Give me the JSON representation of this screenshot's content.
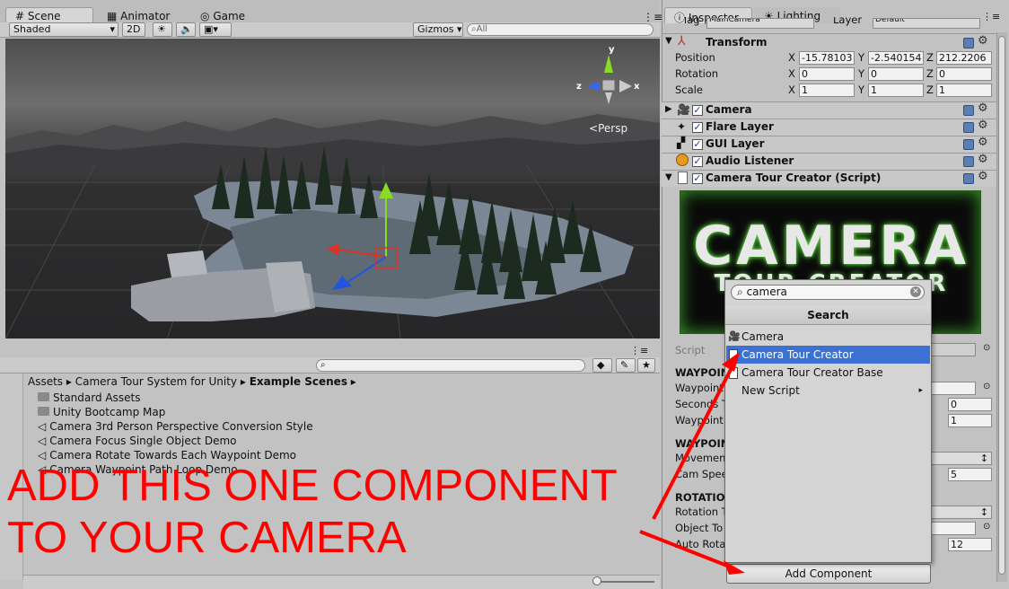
{
  "scene_window": {
    "tabs": [
      {
        "label": "Scene"
      },
      {
        "label": "Animator"
      },
      {
        "label": "Game"
      }
    ],
    "toolbar": {
      "shading": "Shaded",
      "mode_2d": "2D",
      "gizmos": "Gizmos",
      "search_placeholder": "All"
    },
    "persp_label": "Persp",
    "axis_labels": {
      "y": "y",
      "z": "z",
      "x": "x"
    }
  },
  "project_window": {
    "breadcrumb": [
      "Assets",
      "Camera Tour System for Unity",
      "Example Scenes"
    ],
    "items": [
      {
        "label": "Standard Assets",
        "icon": "folder-icon"
      },
      {
        "label": "Unity Bootcamp Map",
        "icon": "folder-icon"
      },
      {
        "label": "Camera 3rd Person Perspective Conversion Style",
        "icon": "unity-scene-icon"
      },
      {
        "label": "Camera Focus Single Object Demo",
        "icon": "unity-scene-icon"
      },
      {
        "label": "Camera Rotate Towards Each Waypoint Demo",
        "icon": "unity-scene-icon"
      },
      {
        "label": "Camera Waypoint Path Loop Demo",
        "icon": "unity-scene-icon"
      }
    ]
  },
  "inspector": {
    "tabs": [
      {
        "label": "Inspector"
      },
      {
        "label": "Lighting"
      }
    ],
    "tag_label": "Tag",
    "tag_value": "MainCamera",
    "layer_label": "Layer",
    "layer_value": "Default",
    "transform": {
      "title": "Transform",
      "position": {
        "label": "Position",
        "x": "-15.78103",
        "y": "-2.540154",
        "z": "212.2206"
      },
      "rotation": {
        "label": "Rotation",
        "x": "0",
        "y": "0",
        "z": "0"
      },
      "scale": {
        "label": "Scale",
        "x": "1",
        "y": "1",
        "z": "1"
      },
      "axis": {
        "x": "X",
        "y": "Y",
        "z": "Z"
      }
    },
    "components": [
      {
        "title": "Camera"
      },
      {
        "title": "Flare Layer"
      },
      {
        "title": "GUI Layer"
      },
      {
        "title": "Audio Listener"
      },
      {
        "title": "Camera Tour Creator (Script)"
      }
    ],
    "banner": {
      "line1": "CAMERA",
      "line2": "TOUR CREATOR"
    },
    "script_label": "Script",
    "fields": {
      "waypoints_header": "WAYPOINTS",
      "waypoint_label": "Waypoint",
      "seconds_label": "Seconds T",
      "waypoint2_label": "Waypoint",
      "seconds_value": "0",
      "waypoint2_value": "1",
      "waypoints2_header": "WAYPOINTS",
      "movement_label": "Movement",
      "cam_speed_label": "Cam Spee",
      "cam_speed_value": "5",
      "rotation_header": "ROTATION",
      "rotation_t_label": "Rotation T",
      "object_to_label": "Object To",
      "auto_rot_label": "Auto Rota",
      "auto_rot_value": "12"
    },
    "add_component": "Add Component"
  },
  "dropdown": {
    "search_value": "camera",
    "header": "Search",
    "items": [
      {
        "label": "Camera",
        "selected": false
      },
      {
        "label": "Camera Tour Creator",
        "selected": true
      },
      {
        "label": "Camera Tour Creator Base",
        "selected": false
      },
      {
        "label": "New Script",
        "selected": false
      }
    ]
  },
  "annotation": {
    "line1": "ADD THIS ONE COMPONENT",
    "line2": "TO YOUR CAMERA",
    "color": "#ff0000"
  }
}
